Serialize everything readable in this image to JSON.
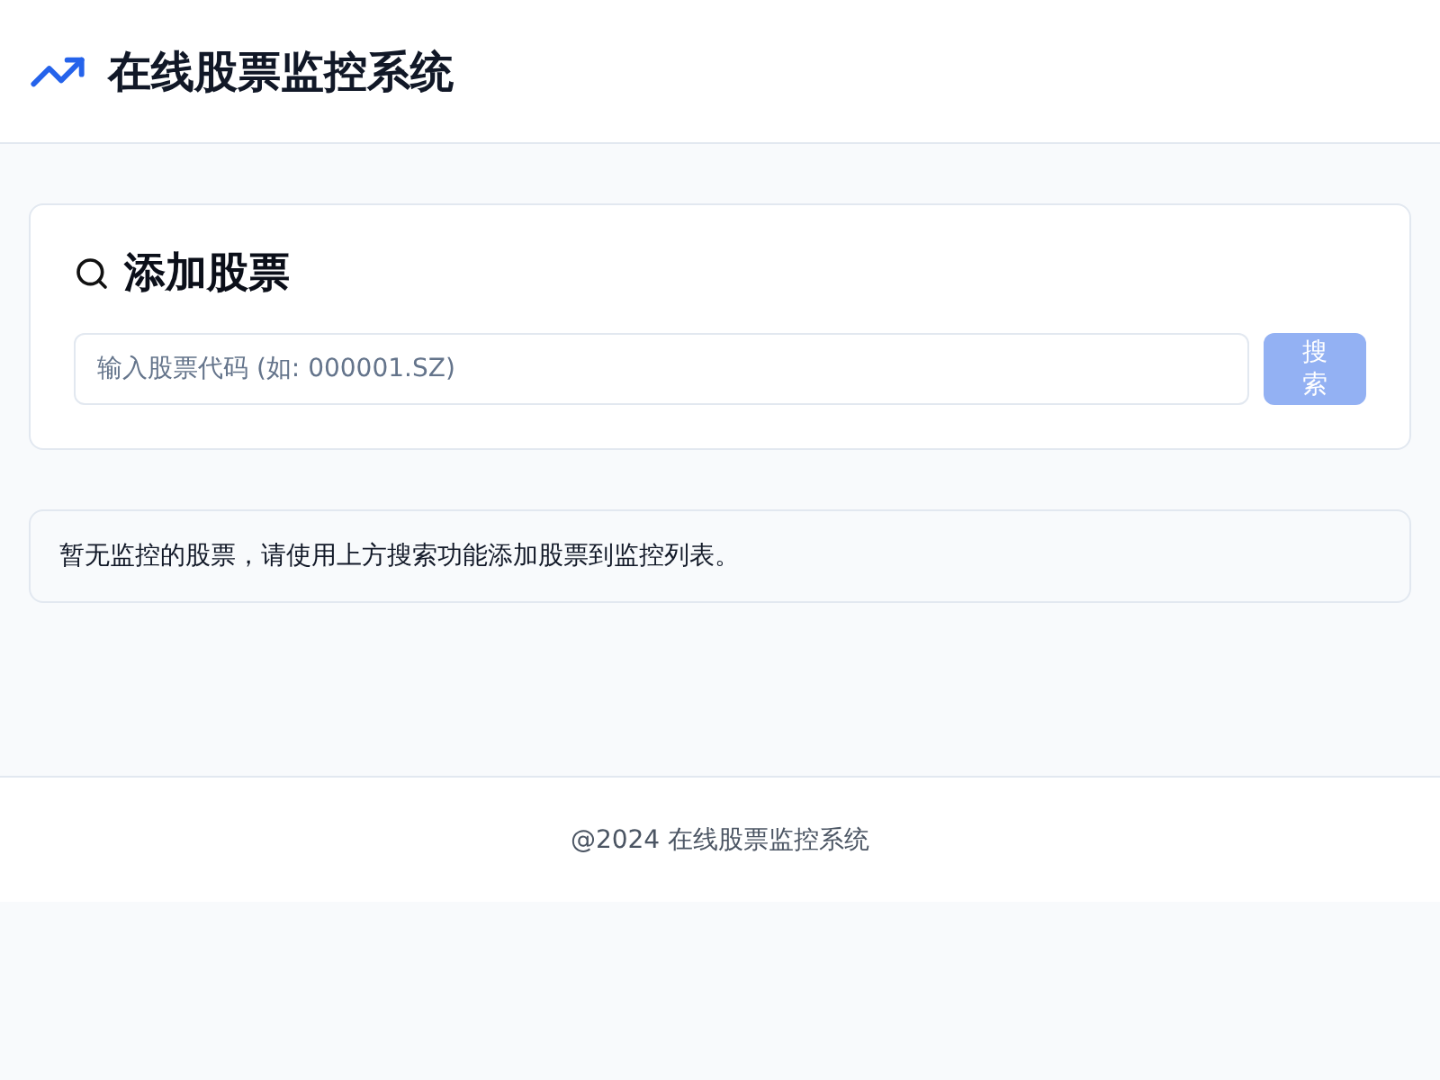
{
  "header": {
    "title": "在线股票监控系统"
  },
  "add_card": {
    "title": "添加股票",
    "search": {
      "placeholder": "输入股票代码 (如: 000001.SZ)"
    },
    "button": {
      "label": "搜索",
      "disabled": true
    }
  },
  "empty_notice": "暂无监控的股票，请使用上方搜索功能添加股票到监控列表。",
  "footer": "@2024 在线股票监控系统"
}
